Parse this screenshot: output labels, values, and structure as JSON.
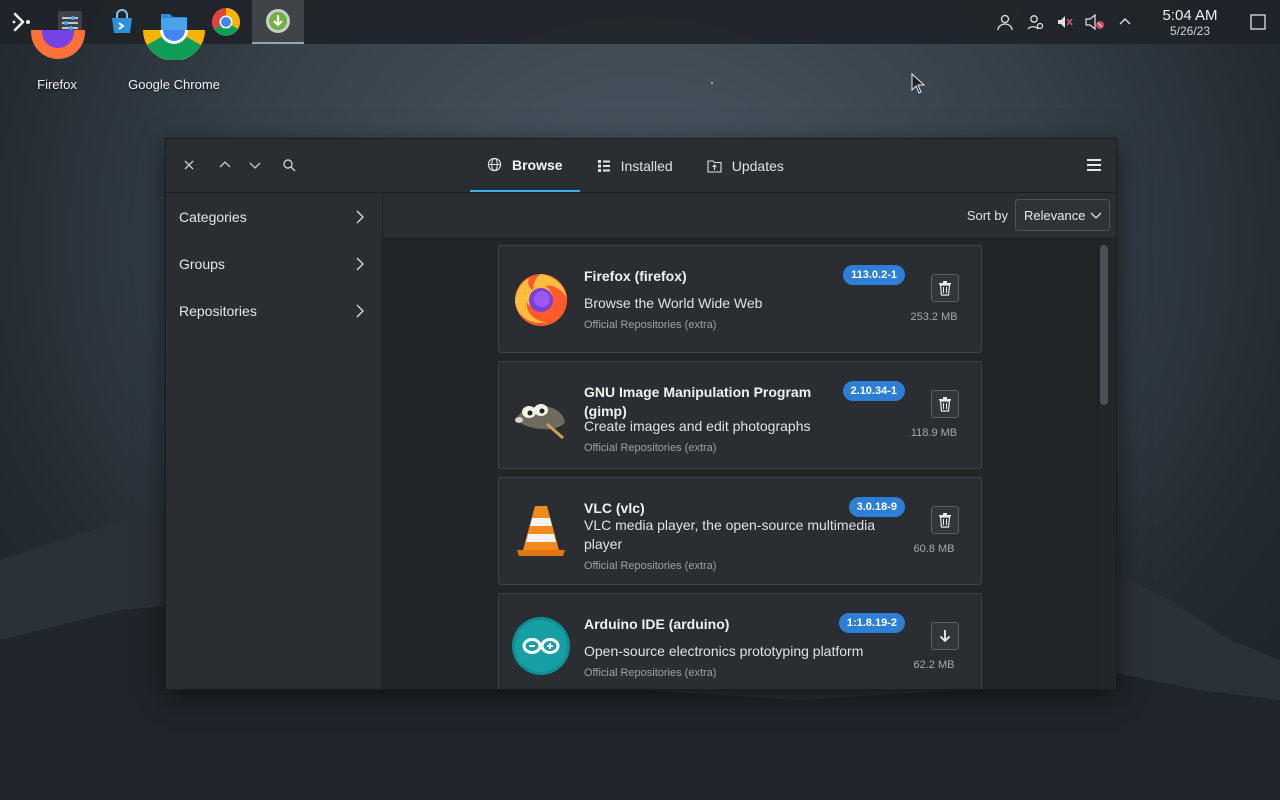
{
  "taskbar": {
    "apps": [
      {
        "name": "system-settings"
      },
      {
        "name": "discover-store"
      },
      {
        "name": "file-manager"
      },
      {
        "name": "google-chrome"
      },
      {
        "name": "software-installer"
      }
    ],
    "clock": {
      "time": "5:04 AM",
      "date": "5/26/23"
    }
  },
  "desktop": {
    "icons": [
      {
        "label": "Firefox"
      },
      {
        "label": "Google Chrome"
      }
    ]
  },
  "window": {
    "tabs": [
      {
        "label": "Browse",
        "active": true
      },
      {
        "label": "Installed",
        "active": false
      },
      {
        "label": "Updates",
        "active": false
      }
    ],
    "sidebar": {
      "items": [
        {
          "label": "Categories"
        },
        {
          "label": "Groups"
        },
        {
          "label": "Repositories"
        }
      ]
    },
    "sort": {
      "label": "Sort by",
      "value": "Relevance"
    },
    "packages": [
      {
        "title": "Firefox (firefox)",
        "description": "Browse the World Wide Web",
        "repository": "Official Repositories (extra)",
        "version": "113.0.2-1",
        "size": "253.2 MB",
        "action": "remove"
      },
      {
        "title": "GNU Image Manipulation Program (gimp)",
        "description": "Create images and edit photographs",
        "repository": "Official Repositories (extra)",
        "version": "2.10.34-1",
        "size": "118.9 MB",
        "action": "remove"
      },
      {
        "title": "VLC (vlc)",
        "description": "VLC media player, the open-source multimedia player",
        "repository": "Official Repositories (extra)",
        "version": "3.0.18-9",
        "size": "60.8 MB",
        "action": "remove"
      },
      {
        "title": "Arduino IDE (arduino)",
        "description": "Open-source electronics prototyping platform",
        "repository": "Official Repositories (extra)",
        "version": "1:1.8.19-2",
        "size": "62.2 MB",
        "action": "install"
      }
    ]
  },
  "colors": {
    "accent": "#3daee9",
    "version_badge": "#2d7fd6",
    "window_bg": "#232629"
  }
}
